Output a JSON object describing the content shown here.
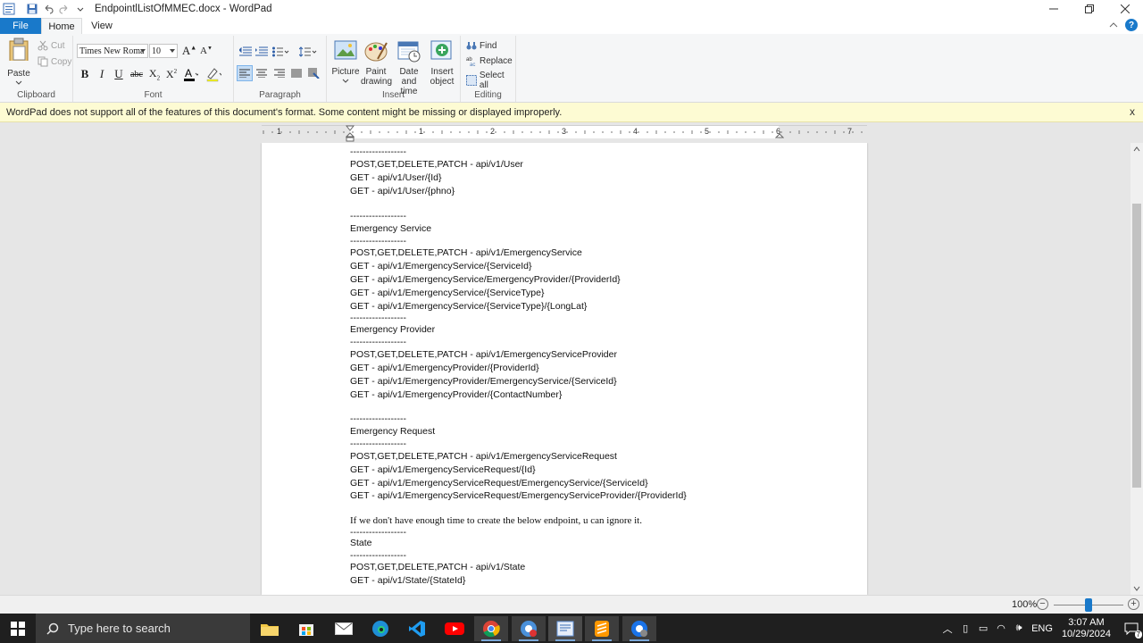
{
  "window": {
    "title": "EndpointlListOfMMEC.docx - WordPad"
  },
  "tabs": {
    "file": "File",
    "home": "Home",
    "view": "View"
  },
  "ribbon": {
    "clipboard": {
      "label": "Clipboard",
      "paste": "Paste",
      "cut": "Cut",
      "copy": "Copy"
    },
    "font": {
      "label": "Font",
      "family": "Times New Roma",
      "size": "10"
    },
    "paragraph": {
      "label": "Paragraph"
    },
    "insert": {
      "label": "Insert",
      "picture": "Picture",
      "paint_1": "Paint",
      "paint_2": "drawing",
      "datetime_1": "Date and",
      "datetime_2": "time",
      "object_1": "Insert",
      "object_2": "object"
    },
    "editing": {
      "label": "Editing",
      "find": "Find",
      "replace": "Replace",
      "select_all": "Select all"
    }
  },
  "infobar": {
    "message": "WordPad does not support all of the features of this document's format. Some content might be missing or displayed improperly.",
    "close": "x"
  },
  "ruler": {
    "numbers": [
      "1",
      "1",
      "2",
      "3",
      "4",
      "5",
      "6",
      "7"
    ]
  },
  "document": {
    "lines": [
      "------------------",
      "POST,GET,DELETE,PATCH - api/v1/User",
      "GET - api/v1/User/{Id}",
      "GET - api/v1/User/{phno}",
      "------------------",
      "Emergency Service",
      "------------------",
      "POST,GET,DELETE,PATCH - api/v1/EmergencyService",
      "GET - api/v1/EmergencyService/{ServiceId}",
      "GET - api/v1/EmergencyService/EmergencyProvider/{ProviderId}",
      "GET - api/v1/EmergencyService/{ServiceType}",
      "GET - api/v1/EmergencyService/{ServiceType}/{LongLat}",
      "------------------",
      "Emergency Provider",
      "------------------",
      "POST,GET,DELETE,PATCH - api/v1/EmergencyServiceProvider",
      "GET - api/v1/EmergencyProvider/{ProviderId}",
      "GET - api/v1/EmergencyProvider/EmergencyService/{ServiceId}",
      "GET - api/v1/EmergencyProvider/{ContactNumber}",
      "------------------",
      "Emergency Request",
      "------------------",
      "POST,GET,DELETE,PATCH - api/v1/EmergencyServiceRequest",
      "GET - api/v1/EmergencyServiceRequest/{Id}",
      "GET - api/v1/EmergencyServiceRequest/EmergencyService/{ServiceId}",
      "GET - api/v1/EmergencyServiceRequest/EmergencyServiceProvider/{ProviderId}",
      "If we don't have enough time to create the below endpoint, u can ignore it.",
      "------------------",
      "State",
      "------------------",
      "POST,GET,DELETE,PATCH - api/v1/State",
      "GET - api/v1/State/{StateId}"
    ]
  },
  "statusbar": {
    "zoom": "100%",
    "minus": "−",
    "plus": "+",
    "zoom_level": 0.5
  },
  "taskbar": {
    "search_placeholder": "Type here to search",
    "language": "ENG",
    "time": "3:07 AM",
    "date": "10/29/2024",
    "notification_count": "7"
  },
  "colors": {
    "accent": "#1979ca",
    "infobar": "#fdfbd3",
    "taskbar": "#1f1f1f"
  }
}
